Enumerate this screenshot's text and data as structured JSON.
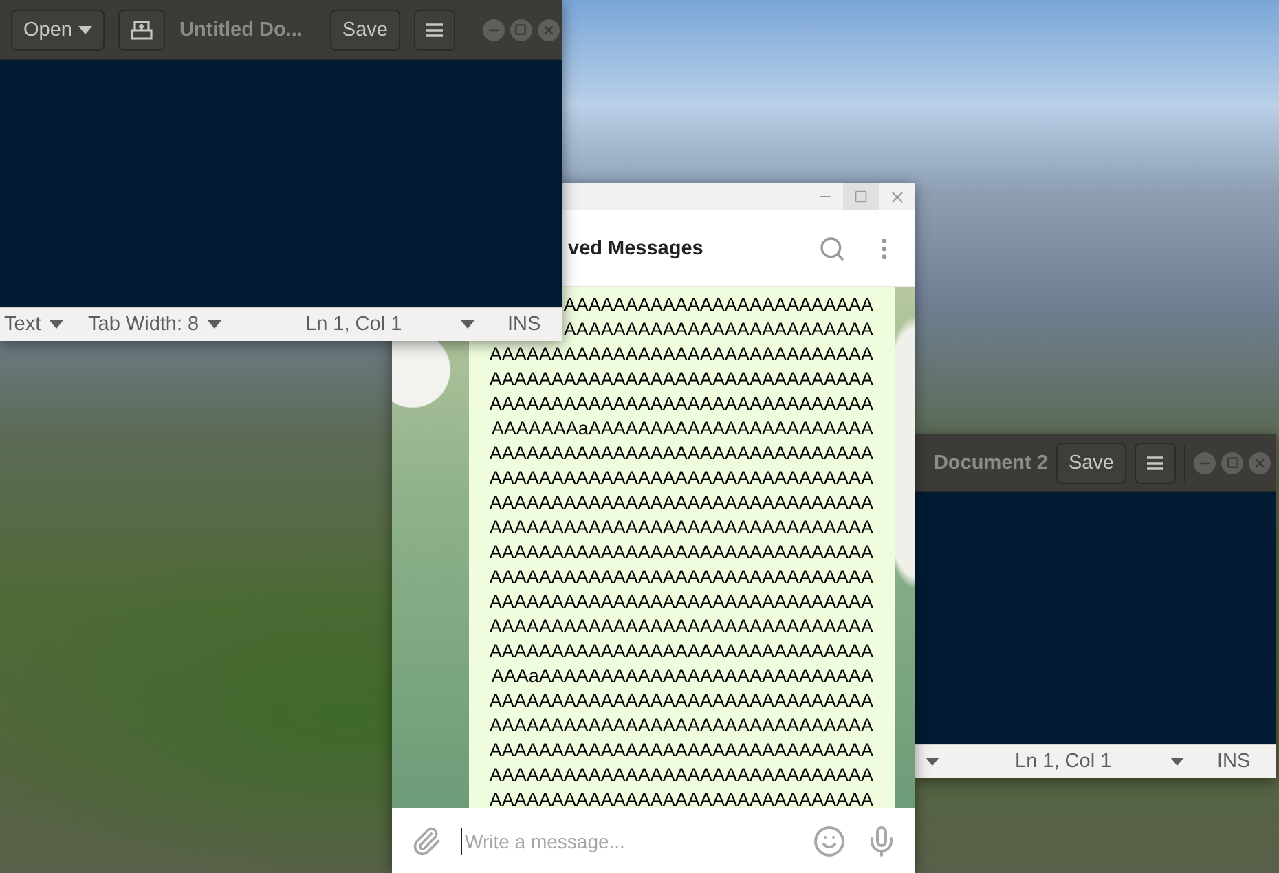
{
  "editor_windows": [
    {
      "title": "Untitled Do...",
      "open_button": "Open",
      "save_button": "Save",
      "status": {
        "language": "Text",
        "tab_width": "Tab Width: 8",
        "position": "Ln 1, Col 1",
        "mode": "INS"
      }
    },
    {
      "title": "Document 2",
      "save_button": "Save",
      "status": {
        "position": "Ln 1, Col 1",
        "mode": "INS"
      }
    }
  ],
  "chat_window": {
    "title": "ved Messages",
    "message_lines": [
      "AAAAAAAAAAAAAAAAAAAAAAAAA",
      "AAAAAAAAAAAAAAAAAAAAAAAAA",
      "AAAAAAAAAAAAAAAAAAAAAAAAAAAAAAA",
      "AAAAAAAAAAAAAAAAAAAAAAAAAAAAAAA",
      "AAAAAAAAAAAAAAAAAAAAAAAAAAAAAAA",
      "AAAAAAAaAAAAAAAAAAAAAAAAAAAAAAA",
      "AAAAAAAAAAAAAAAAAAAAAAAAAAAAAAA",
      "AAAAAAAAAAAAAAAAAAAAAAAAAAAAAAA",
      "AAAAAAAAAAAAAAAAAAAAAAAAAAAAAAA",
      "AAAAAAAAAAAAAAAAAAAAAAAAAAAAAAA",
      "AAAAAAAAAAAAAAAAAAAAAAAAAAAAAAA",
      "AAAAAAAAAAAAAAAAAAAAAAAAAAAAAAA",
      "AAAAAAAAAAAAAAAAAAAAAAAAAAAAAAA",
      "AAAAAAAAAAAAAAAAAAAAAAAAAAAAAAA",
      "AAAAAAAAAAAAAAAAAAAAAAAAAAAAAAA",
      "AAAaAAAAAAAAAAAAAAAAAAAAAAAAAAA",
      "AAAAAAAAAAAAAAAAAAAAAAAAAAAAAAA",
      "AAAAAAAAAAAAAAAAAAAAAAAAAAAAAAA",
      "AAAAAAAAAAAAAAAAAAAAAAAAAAAAAAA",
      "AAAAAAAAAAAAAAAAAAAAAAAAAAAAAAA",
      "AAAAAAAAAAAAAAAAAAAAAAAAAAAAAAA"
    ],
    "input": {
      "placeholder": "Write a message..."
    }
  }
}
